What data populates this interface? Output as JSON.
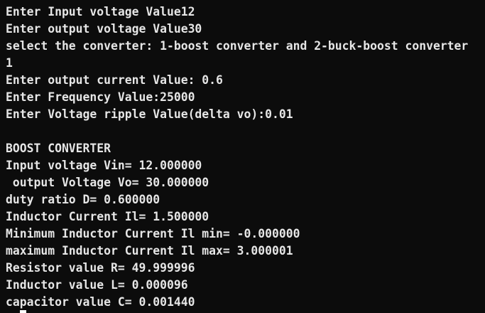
{
  "terminal": {
    "lines": [
      "Enter Input voltage Value12",
      "Enter output voltage Value30",
      "select the converter: 1-boost converter and 2-buck-boost converter",
      "1",
      "Enter output current Value: 0.6",
      "Enter Frequency Value:25000",
      "Enter Voltage ripple Value(delta vo):0.01",
      "",
      "BOOST CONVERTER",
      "Input voltage Vin= 12.000000",
      " output Voltage Vo= 30.000000",
      "duty ratio D= 0.600000",
      "Inductor Current Il= 1.500000",
      "Minimum Inductor Current Il min= -0.000000",
      "maximum Inductor Current Il max= 3.000001",
      "Resistor value R= 49.999996",
      "Inductor value L= 0.000096",
      "capacitor value C= 0.001440"
    ]
  },
  "colors": {
    "background": "#0c0c0c",
    "text": "#e6e6e6",
    "cursor": "#ffffff"
  }
}
